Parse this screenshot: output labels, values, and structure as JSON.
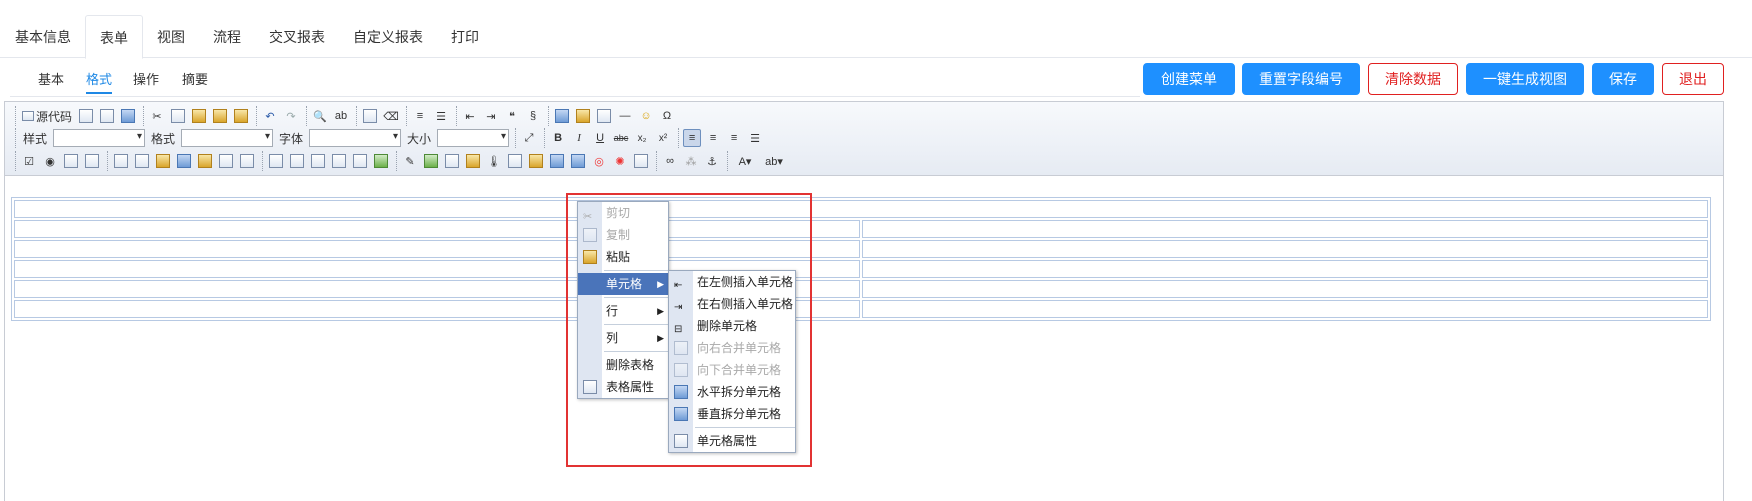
{
  "top_tabs": [
    {
      "label": "基本信息"
    },
    {
      "label": "表单"
    },
    {
      "label": "视图"
    },
    {
      "label": "流程"
    },
    {
      "label": "交叉报表"
    },
    {
      "label": "自定义报表"
    },
    {
      "label": "打印"
    }
  ],
  "active_top_tab": "表单",
  "sub_tabs": [
    {
      "label": "基本"
    },
    {
      "label": "格式"
    },
    {
      "label": "操作"
    },
    {
      "label": "摘要"
    }
  ],
  "active_sub_tab": "格式",
  "actions": {
    "create_menu": "创建菜单",
    "reset_field_numbers": "重置字段编号",
    "clear_data": "清除数据",
    "generate_view": "一键生成视图",
    "save": "保存",
    "exit": "退出"
  },
  "toolbar": {
    "source_label": "源代码",
    "style_label": "样式",
    "format_label": "格式",
    "font_label": "字体",
    "size_label": "大小",
    "bold": "B",
    "italic": "I",
    "underline": "U",
    "strike": "abc",
    "subscript": "x₂",
    "superscript": "x²",
    "omega": "Ω",
    "quote": "❝"
  },
  "context_menu": {
    "items": [
      {
        "label": "剪切",
        "disabled": true,
        "icon": "cut-icon"
      },
      {
        "label": "复制",
        "disabled": true,
        "icon": "copy-icon"
      },
      {
        "label": "粘贴",
        "disabled": false,
        "icon": "paste-icon"
      },
      {
        "label": "单元格",
        "disabled": false,
        "submenu": true
      },
      {
        "label": "行",
        "disabled": false,
        "submenu": true
      },
      {
        "label": "列",
        "disabled": false,
        "submenu": true
      },
      {
        "label": "删除表格",
        "disabled": false
      },
      {
        "label": "表格属性",
        "disabled": false,
        "icon": "table-properties-icon"
      }
    ],
    "highlighted": "单元格"
  },
  "cell_submenu": {
    "items": [
      {
        "label": "在左侧插入单元格",
        "disabled": false
      },
      {
        "label": "在右侧插入单元格",
        "disabled": false
      },
      {
        "label": "删除单元格",
        "disabled": false
      },
      {
        "label": "向右合并单元格",
        "disabled": true
      },
      {
        "label": "向下合并单元格",
        "disabled": true
      },
      {
        "label": "水平拆分单元格",
        "disabled": false
      },
      {
        "label": "垂直拆分单元格",
        "disabled": false
      },
      {
        "label": "单元格属性",
        "disabled": false
      }
    ]
  },
  "colors": {
    "primary": "#1e90ff",
    "danger": "#e02020",
    "highlight": "#4a74ba",
    "frame": "#e23333"
  }
}
